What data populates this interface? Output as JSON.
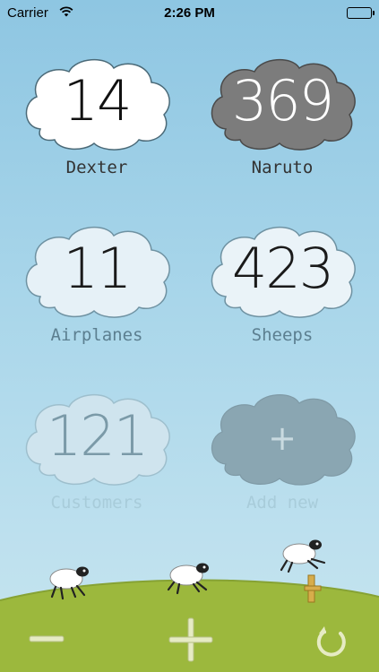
{
  "status_bar": {
    "carrier": "Carrier",
    "time": "2:26 PM",
    "battery_level": 1.0
  },
  "counters": [
    {
      "value": "14",
      "label": "Dexter",
      "style": "white"
    },
    {
      "value": "369",
      "label": "Naruto",
      "style": "dark"
    },
    {
      "value": "11",
      "label": "Airplanes",
      "style": "light"
    },
    {
      "value": "423",
      "label": "Sheeps",
      "style": "light"
    },
    {
      "value": "121",
      "label": "Customers",
      "style": "faded"
    }
  ],
  "add_new": {
    "symbol": "+",
    "label": "Add new"
  },
  "toolbar": {
    "decrement_icon": "minus-icon",
    "increment_icon": "plus-icon",
    "reset_icon": "refresh-icon"
  },
  "colors": {
    "sky_top": "#8ec6e2",
    "sky_bottom": "#c7e5ee",
    "hill": "#9cb83d",
    "cloud_white": "#ffffff",
    "cloud_dark": "#7c7c7c",
    "cloud_light": "#e6f1f7"
  }
}
